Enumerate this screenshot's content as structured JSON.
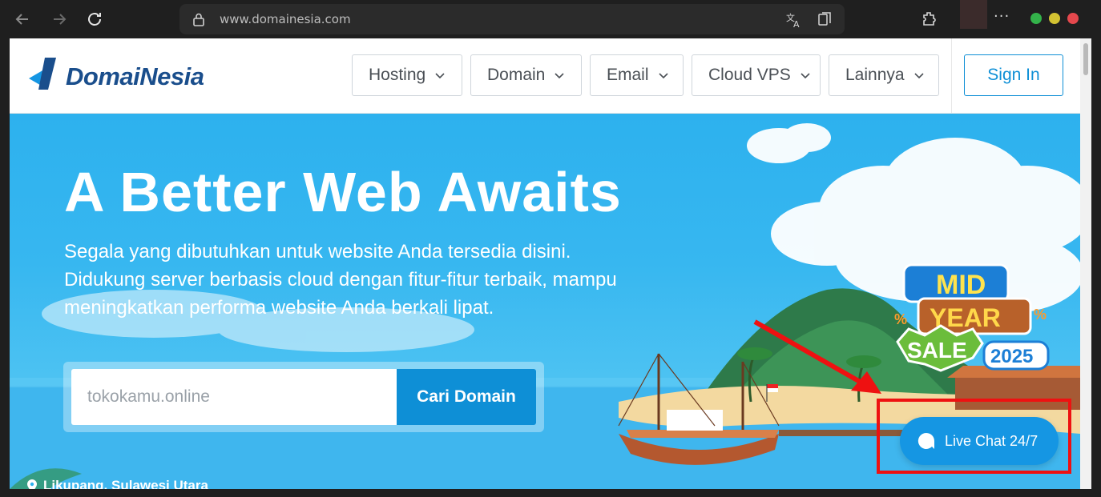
{
  "browser": {
    "url": "www.domainesia.com",
    "icons": [
      "back-icon",
      "forward-icon",
      "reload-icon",
      "lock-icon",
      "translate-icon",
      "reading-list-icon",
      "extensions-icon",
      "more-icon"
    ],
    "more_label": "···"
  },
  "site": {
    "logo_text": "DomaiNesia",
    "menu": [
      {
        "label": "Hosting"
      },
      {
        "label": "Domain"
      },
      {
        "label": "Email"
      },
      {
        "label": "Cloud VPS"
      },
      {
        "label": "Lainnya"
      }
    ],
    "signin_label": "Sign In"
  },
  "hero": {
    "title": "A Better Web Awaits",
    "subtitle": "Segala yang dibutuhkan untuk website Anda tersedia disini. Didukung server berbasis cloud dengan fitur-fitur terbaik, mampu meningkatkan performa website Anda berkali lipat.",
    "search_placeholder": "tokokamu.online",
    "search_button": "Cari Domain",
    "location": "Likupang, Sulawesi Utara"
  },
  "promo": {
    "line1": "MID",
    "line2": "YEAR",
    "line3": "SALE",
    "year": "2025"
  },
  "livechat": {
    "label": "Live Chat 24/7"
  },
  "colors": {
    "accent": "#0e8fd6",
    "hero_sky": "#2db1ee",
    "highlight": "#ee1111",
    "logo": "#1a4e8c"
  }
}
